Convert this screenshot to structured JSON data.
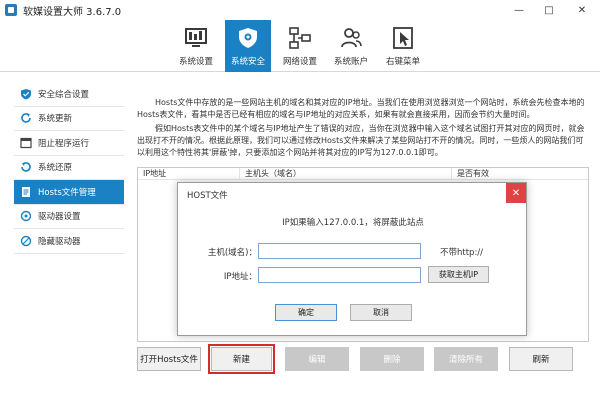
{
  "window": {
    "title": "软媒设置大师 3.6.7.0",
    "min_glyph": "—",
    "max_glyph": "□",
    "close_glyph": "✕"
  },
  "toolbar": {
    "tabs": [
      {
        "label": "系统设置",
        "icon": "monitor-icon"
      },
      {
        "label": "系统安全",
        "icon": "shield-icon",
        "active": true
      },
      {
        "label": "网络设置",
        "icon": "network-icon"
      },
      {
        "label": "系统账户",
        "icon": "users-icon"
      },
      {
        "label": "右键菜单",
        "icon": "cursor-icon"
      }
    ]
  },
  "sidebar": {
    "items": [
      {
        "label": "安全综合设置",
        "icon": "shield-check-icon"
      },
      {
        "label": "系统更新",
        "icon": "refresh-icon"
      },
      {
        "label": "阻止程序运行",
        "icon": "block-icon"
      },
      {
        "label": "系统还原",
        "icon": "restore-icon"
      },
      {
        "label": "Hosts文件管理",
        "icon": "document-icon",
        "active": true
      },
      {
        "label": "驱动器设置",
        "icon": "drive-icon"
      },
      {
        "label": "隐藏驱动器",
        "icon": "hidden-drive-icon"
      }
    ]
  },
  "description": {
    "p1": "Hosts文件中存放的是一些网站主机的域名和其对应的IP地址。当我们在使用浏览器浏览一个网站时，系统会先检查本地的Hosts表文件，看其中是否已经有相应的域名与IP地址的对应关系，如果有就会直接采用，因而会节约大量时间。",
    "p2": "假如Hosts表文件中的某个域名与IP地址产生了错误的对应，当你在浏览器中输入这个域名试图打开其对应的网页时，就会出现打不开的情况。根据此原理，我们可以通过修改Hosts文件来解决了某些网站打不开的情况。同时，一些烦人的网站我们可以利用这个特性将其'屏蔽'掉，只要添加这个网站并将其对应的IP写为127.0.0.1即可。"
  },
  "table": {
    "columns": [
      "IP地址",
      "主机头（域名）",
      "是否有效"
    ]
  },
  "buttons": {
    "open_hosts": "打开Hosts文件",
    "new": "新建",
    "edit": "编辑",
    "delete": "删除",
    "clear_all": "清除所有",
    "refresh": "刷新"
  },
  "dialog": {
    "title": "HOST文件",
    "close_glyph": "✕",
    "note": "IP如果输入127.0.0.1，将屏蔽此站点",
    "host_label": "主机(域名)：",
    "host_value": "",
    "host_hint": "不带http://",
    "ip_label": "IP地址：",
    "ip_value": "",
    "get_ip_button": "获取主机IP",
    "ok_button": "确定",
    "cancel_button": "取消"
  },
  "colors": {
    "accent": "#1a82c4",
    "highlight": "#d42b2b",
    "dialog_close": "#e04343"
  }
}
